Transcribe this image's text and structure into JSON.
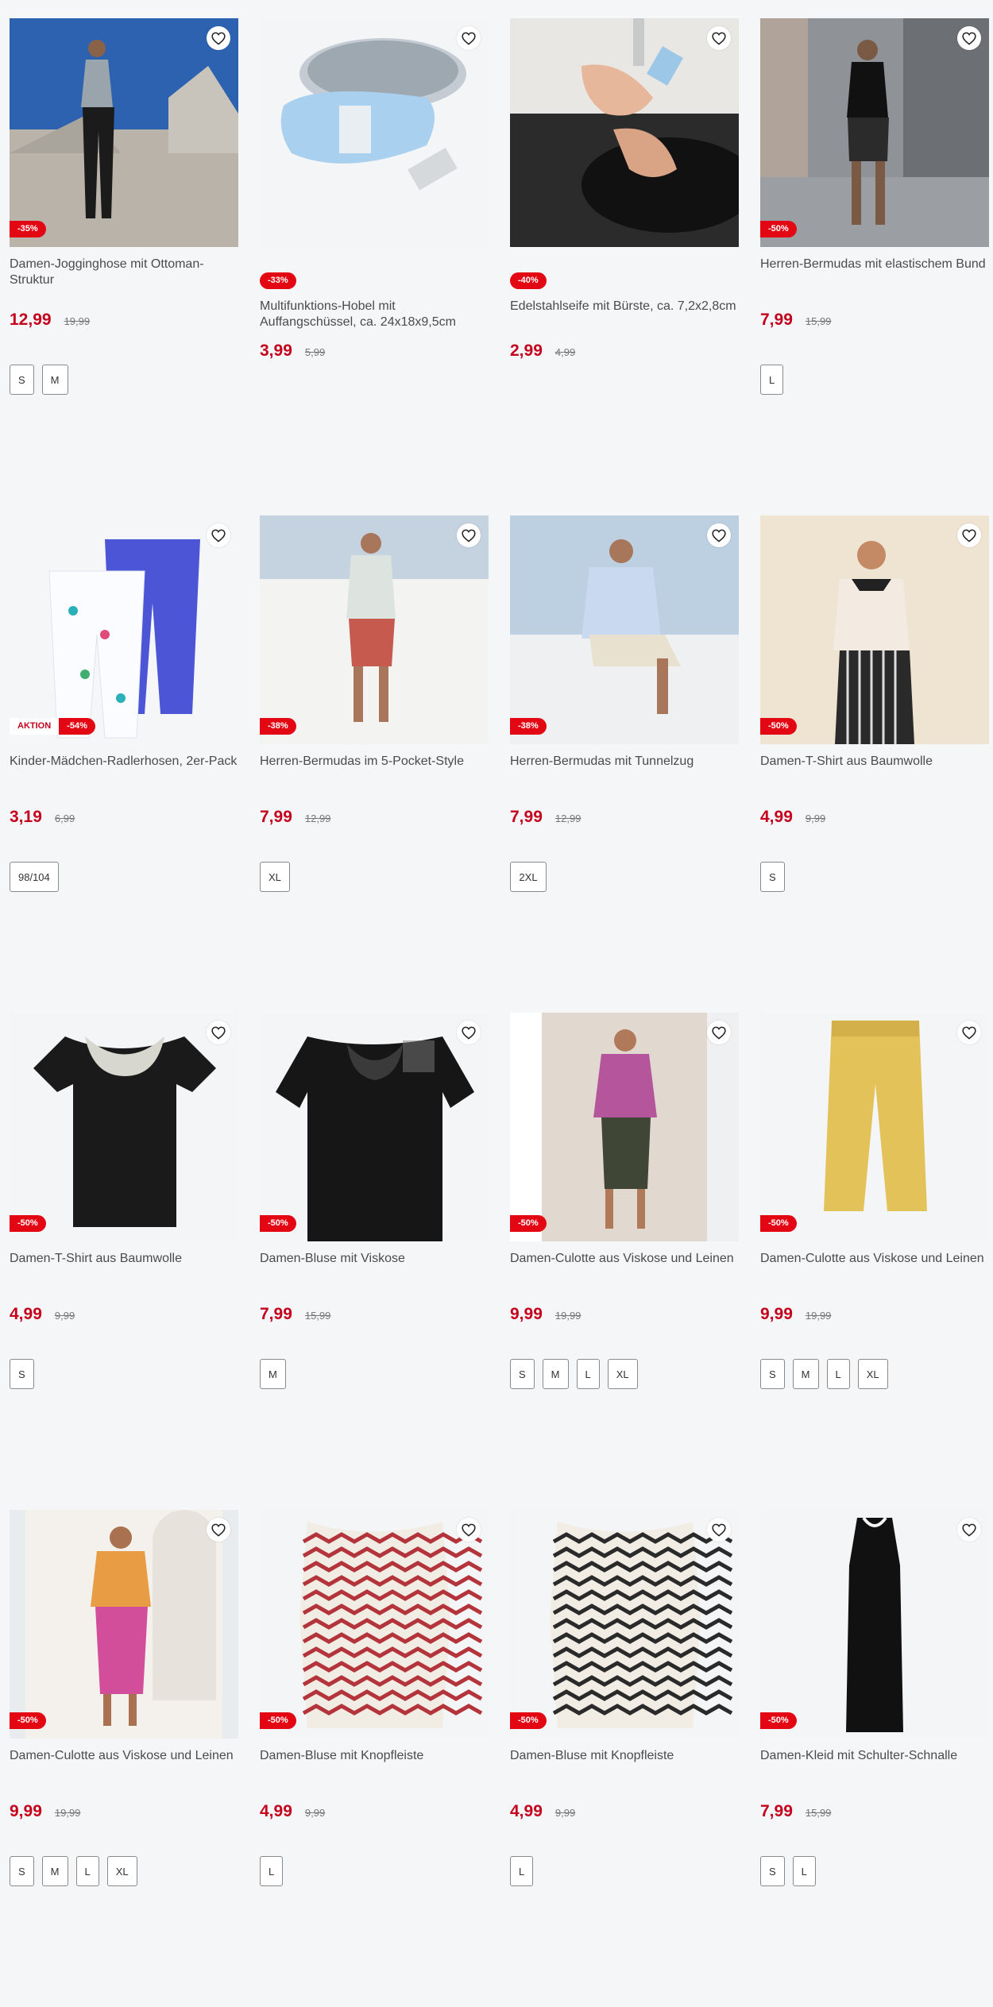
{
  "products": [
    {
      "title": "Damen-Jogginghose mit Ottoman-Struktur",
      "price": "12,99",
      "old_price": "19,99",
      "badge": "-35%",
      "sizes": [
        "S",
        "M"
      ],
      "scene": "woman-grey"
    },
    {
      "title": "Multifunktions-Hobel mit Auffangschüssel, ca. 24x18x9,5cm",
      "price": "3,99",
      "old_price": "5,99",
      "badge": "-33%",
      "sizes": [],
      "scene": "grater"
    },
    {
      "title": "Edelstahlseife mit Bürste, ca. 7,2x2,8cm",
      "price": "2,99",
      "old_price": "4,99",
      "badge": "-40%",
      "sizes": [],
      "scene": "soap"
    },
    {
      "title": "Herren-Bermudas mit elastischem Bund",
      "price": "7,99",
      "old_price": "15,99",
      "badge": "-50%",
      "sizes": [
        "L"
      ],
      "scene": "man-street"
    },
    {
      "title": "Kinder-Mädchen-Radlerhosen, 2er-Pack",
      "price": "3,19",
      "old_price": "6,99",
      "badge": "-54%",
      "aktion": "AKTION",
      "sizes": [
        "98/104"
      ],
      "scene": "kids-shorts"
    },
    {
      "title": "Herren-Bermudas im 5-Pocket-Style",
      "price": "7,99",
      "old_price": "12,99",
      "badge": "-38%",
      "sizes": [
        "XL"
      ],
      "scene": "man-red"
    },
    {
      "title": "Herren-Bermudas mit Tunnelzug",
      "price": "7,99",
      "old_price": "12,99",
      "badge": "-38%",
      "sizes": [
        "2XL"
      ],
      "scene": "man-sitting"
    },
    {
      "title": "Damen-T-Shirt aus Baumwolle",
      "price": "4,99",
      "old_price": "9,99",
      "badge": "-50%",
      "sizes": [
        "S"
      ],
      "scene": "woman-tee"
    },
    {
      "title": "Damen-T-Shirt aus Baumwolle",
      "price": "4,99",
      "old_price": "9,99",
      "badge": "-50%",
      "sizes": [
        "S"
      ],
      "scene": "black-tee-lace"
    },
    {
      "title": "Damen-Bluse mit Viskose",
      "price": "7,99",
      "old_price": "15,99",
      "badge": "-50%",
      "sizes": [
        "M"
      ],
      "scene": "black-blouse"
    },
    {
      "title": "Damen-Culotte aus Viskose und Leinen",
      "price": "9,99",
      "old_price": "19,99",
      "badge": "-50%",
      "sizes": [
        "S",
        "M",
        "L",
        "XL"
      ],
      "scene": "woman-pink"
    },
    {
      "title": "Damen-Culotte aus Viskose und Leinen",
      "price": "9,99",
      "old_price": "19,99",
      "badge": "-50%",
      "sizes": [
        "S",
        "M",
        "L",
        "XL"
      ],
      "scene": "yellow-pants"
    },
    {
      "title": "Damen-Culotte aus Viskose und Leinen",
      "price": "9,99",
      "old_price": "19,99",
      "badge": "-50%",
      "sizes": [
        "S",
        "M",
        "L",
        "XL"
      ],
      "scene": "woman-magenta"
    },
    {
      "title": "Damen-Bluse mit Knopfleiste",
      "price": "4,99",
      "old_price": "9,99",
      "badge": "-50%",
      "sizes": [
        "L"
      ],
      "scene": "zigzag-red"
    },
    {
      "title": "Damen-Bluse mit Knopfleiste",
      "price": "4,99",
      "old_price": "9,99",
      "badge": "-50%",
      "sizes": [
        "L"
      ],
      "scene": "zigzag-black"
    },
    {
      "title": "Damen-Kleid mit Schulter-Schnalle",
      "price": "7,99",
      "old_price": "15,99",
      "badge": "-50%",
      "sizes": [
        "S",
        "L"
      ],
      "scene": "black-dress"
    }
  ],
  "colors": {
    "price": "#c4001d",
    "badge": "#e30613"
  },
  "icons": {
    "wishlist": "heart-outline-icon"
  }
}
